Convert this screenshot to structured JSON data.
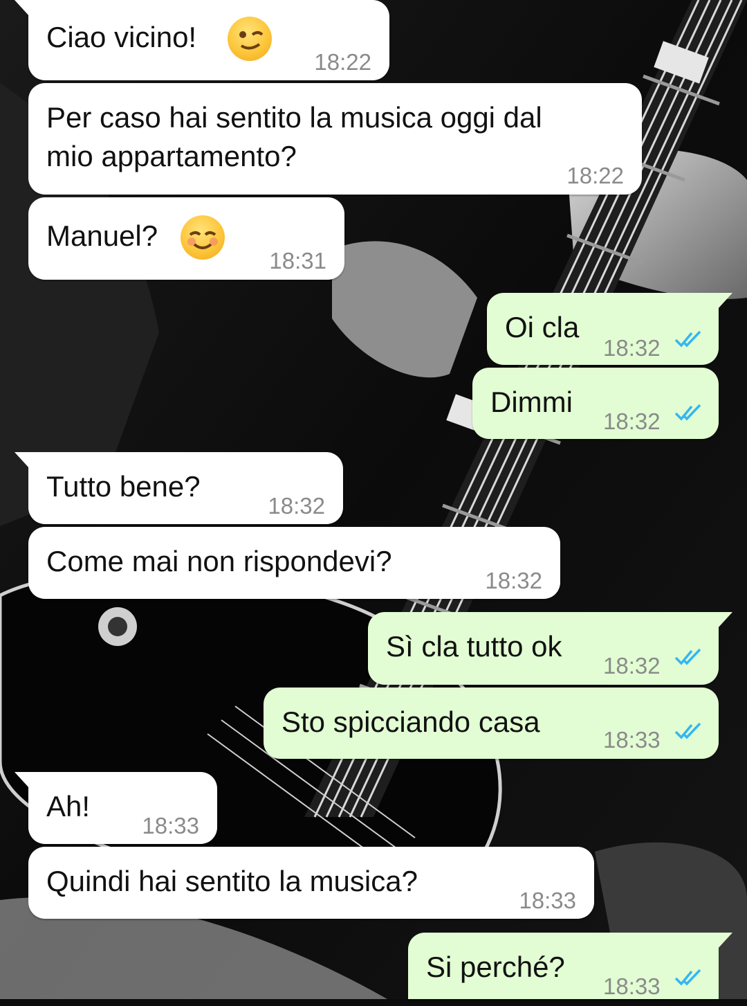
{
  "colors": {
    "incoming_bubble": "#ffffff",
    "outgoing_bubble": "#e2fdd3",
    "timestamp": "#8a8a8a",
    "read_ticks": "#34b7f1"
  },
  "messages": [
    {
      "text": "Ciao vicino!",
      "time": "18:22",
      "emoji": "winking-face"
    },
    {
      "text": "Per caso hai sentito la musica oggi dal\nmio appartamento?",
      "time": "18:22"
    },
    {
      "text": "Manuel?",
      "time": "18:31",
      "emoji": "smiling-face"
    },
    {
      "text": "Oi cla",
      "time": "18:32",
      "status": "read"
    },
    {
      "text": "Dimmi",
      "time": "18:32",
      "status": "read"
    },
    {
      "text": "Tutto bene?",
      "time": "18:32"
    },
    {
      "text": "Come mai non rispondevi?",
      "time": "18:32"
    },
    {
      "text": "Sì cla tutto ok",
      "time": "18:32",
      "status": "read"
    },
    {
      "text": "Sto spicciando casa",
      "time": "18:33",
      "status": "read"
    },
    {
      "text": "Ah!",
      "time": "18:33"
    },
    {
      "text": "Quindi hai sentito la musica?",
      "time": "18:33"
    },
    {
      "text": "Si perché?",
      "time": "18:33",
      "status": "read"
    }
  ]
}
